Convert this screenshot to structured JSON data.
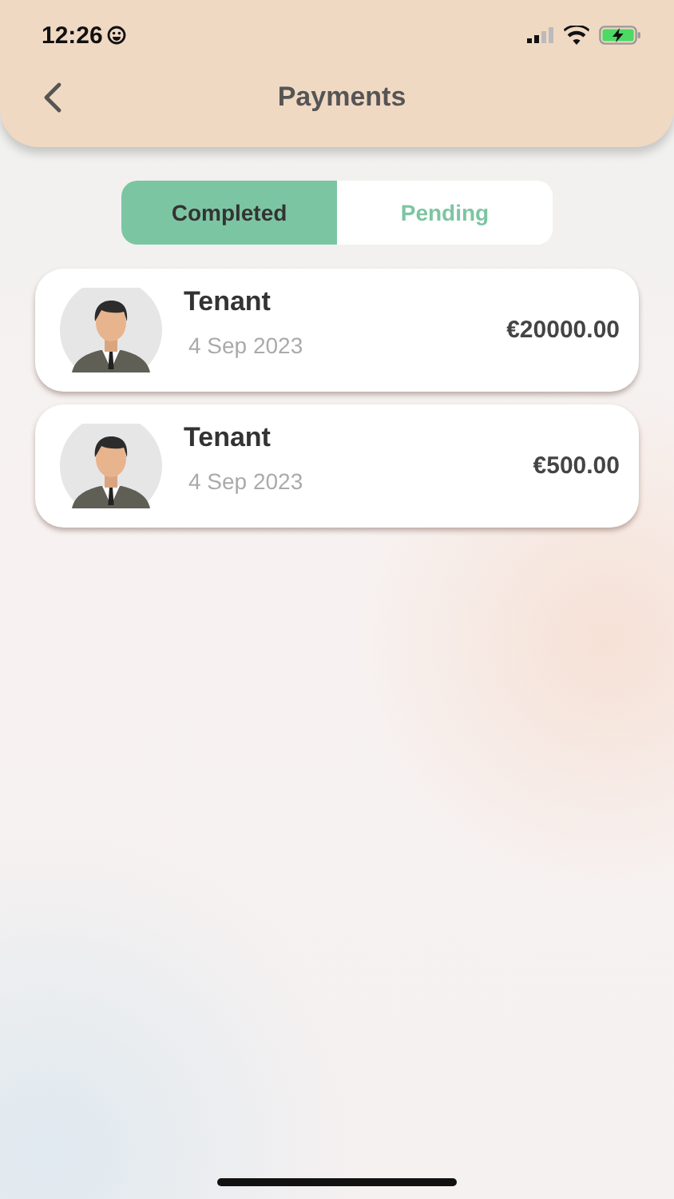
{
  "status_bar": {
    "time": "12:26"
  },
  "header": {
    "title": "Payments"
  },
  "tabs": [
    {
      "label": "Completed",
      "selected": true
    },
    {
      "label": "Pending",
      "selected": false
    }
  ],
  "payments": [
    {
      "name": "Tenant",
      "date": "4 Sep 2023",
      "amount": "€20000.00"
    },
    {
      "name": "Tenant",
      "date": "4 Sep 2023",
      "amount": "€500.00"
    }
  ]
}
